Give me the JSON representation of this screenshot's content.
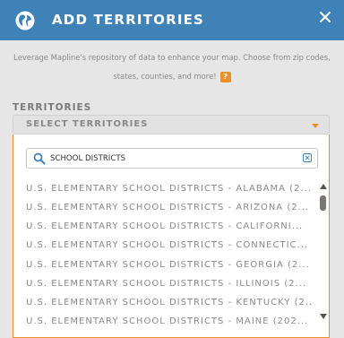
{
  "header": {
    "title": "ADD TERRITORIES",
    "globe_icon": "globe-icon",
    "close_icon": "close-icon",
    "background_color": "#3f82b8"
  },
  "info": {
    "line1": "Leverage Mapline's repository of data to enhance your map. Choose from zip codes,",
    "line2": "states, counties, and more!",
    "help_label": "?"
  },
  "territories": {
    "section_label": "TERRITORIES",
    "select_placeholder": "SELECT TERRITORIES",
    "accent_color": "#e8912a"
  },
  "search": {
    "value": "SCHOOL DISTRICTS",
    "search_icon": "search-icon",
    "clear_icon": "clear-icon"
  },
  "options": [
    "U.S. ELEMENTARY SCHOOL DISTRICTS - ALABAMA (2...",
    "U.S. ELEMENTARY SCHOOL DISTRICTS - ARIZONA (2...",
    "U.S. ELEMENTARY SCHOOL DISTRICTS - CALIFORNI...",
    "U.S. ELEMENTARY SCHOOL DISTRICTS - CONNECTIC...",
    "U.S. ELEMENTARY SCHOOL DISTRICTS - GEORGIA (2...",
    "U.S. ELEMENTARY SCHOOL DISTRICTS - ILLINOIS (2...",
    "U.S. ELEMENTARY SCHOOL DISTRICTS - KENTUCKY (2...",
    "U.S. ELEMENTARY SCHOOL DISTRICTS - MAINE (202..."
  ]
}
